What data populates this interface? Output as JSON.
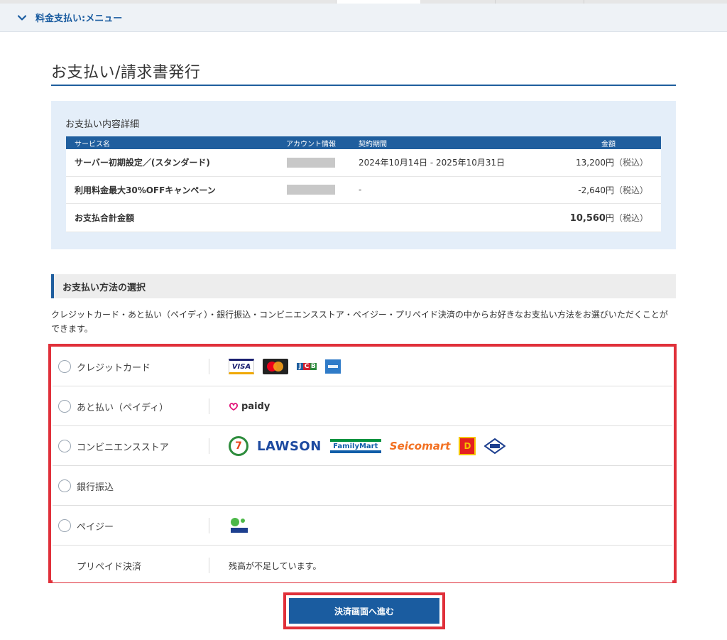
{
  "menu": {
    "title": "料金支払い:メニュー"
  },
  "page": {
    "title": "お支払い/請求書発行"
  },
  "detail": {
    "heading": "お支払い内容詳細",
    "columns": [
      "サービス名",
      "アカウント情報",
      "契約期間",
      "金額"
    ],
    "rows": [
      {
        "name": "サーバー初期設定／(スタンダード)",
        "term": "2024年10月14日 - 2025年10月31日",
        "amount": "13,200円",
        "tax": "（税込）"
      },
      {
        "name": "利用料金最大30%OFFキャンペーン",
        "term": "-",
        "amount": "-2,640円",
        "tax": "（税込）"
      }
    ],
    "total": {
      "label": "お支払合計金額",
      "amount": "10,560",
      "unit": "円",
      "tax": "（税込）"
    }
  },
  "method": {
    "heading": "お支払い方法の選択",
    "description": "クレジットカード・あと払い（ペイディ）・銀行振込・コンビニエンスストア・ペイジー・プリペイド決済の中からお好きなお支払い方法をお選びいただくことができます。",
    "options": [
      {
        "label": "クレジットカード"
      },
      {
        "label": "あと払い（ペイディ）"
      },
      {
        "label": "コンビニエンスストア"
      },
      {
        "label": "銀行振込"
      },
      {
        "label": "ペイジー"
      },
      {
        "label": "プリペイド決済",
        "note": "残高が不足しています。"
      }
    ],
    "logos": {
      "visa": "VISA",
      "jcb": [
        "J",
        "C",
        "B"
      ],
      "paidy": "paidy",
      "seven": "7",
      "lawson": "LAWSON",
      "familymart": "FamilyMart",
      "seicomart": "Seicomart",
      "daily": "D"
    }
  },
  "submit": {
    "label": "決済画面へ進む"
  },
  "colors": {
    "primary": "#1f5e9e",
    "highlight": "#e0303a",
    "panel": "#e4eef9"
  }
}
